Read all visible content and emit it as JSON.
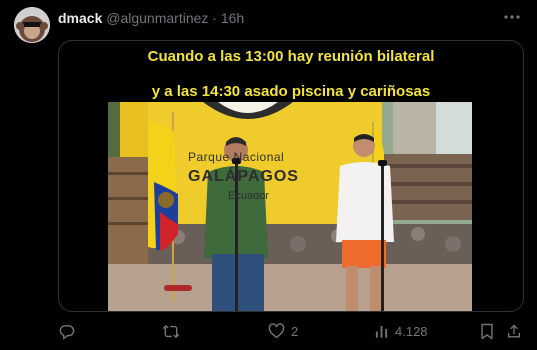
{
  "tweet": {
    "author_name": "dmack",
    "author_handle": "@algunmartinez",
    "separator": "·",
    "time": "16h",
    "caption_line1": "Cuando a las 13:00 hay reunión bilateral",
    "caption_line2": "y a las 14:30 asado piscina y cariñosas",
    "sign_line1": "Parque Nacional",
    "sign_line2": "GALÁPAGOS",
    "sign_line3": "Ecuador",
    "likes": "2",
    "views": "4.128"
  },
  "icons": [
    "more-icon",
    "reply-icon",
    "retweet-icon",
    "like-icon",
    "views-icon",
    "bookmark-icon",
    "share-icon"
  ],
  "colors": {
    "caption": "#f1e23c",
    "muted": "#71767b",
    "border": "#2f3336"
  }
}
